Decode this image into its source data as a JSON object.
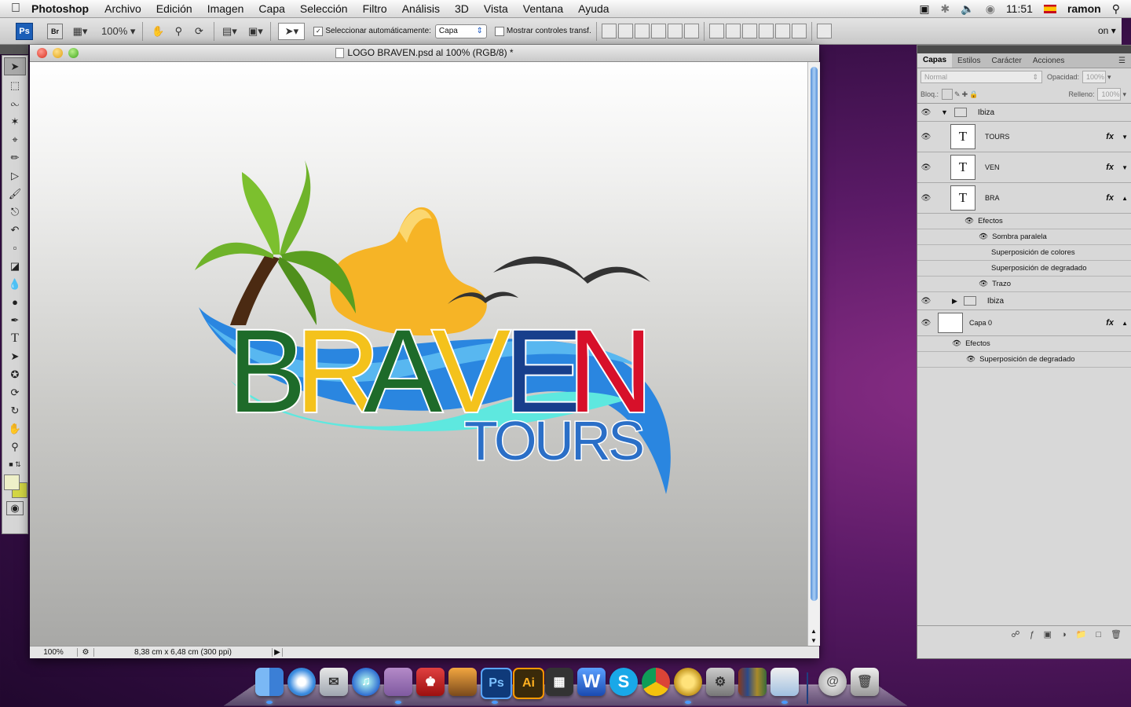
{
  "menubar": {
    "app_name": "Photoshop",
    "menus": [
      "Archivo",
      "Edición",
      "Imagen",
      "Capa",
      "Selección",
      "Filtro",
      "Análisis",
      "3D",
      "Vista",
      "Ventana",
      "Ayuda"
    ],
    "clock": "11:51",
    "user": "ramon"
  },
  "options": {
    "ps_logo": "Ps",
    "br_logo": "Br",
    "zoom": "100%",
    "auto_select_label": "Seleccionar automáticamente:",
    "auto_select_value": "Capa",
    "show_transform_label": "Mostrar controles transf.",
    "trailing_label": "on"
  },
  "document": {
    "title": "LOGO BRAVEN.psd al 100% (RGB/8) *",
    "status_zoom": "100%",
    "status_info": "8,38 cm x 6,48 cm (300 ppi)"
  },
  "logo": {
    "letters": [
      "B",
      "R",
      "A",
      "V",
      "E",
      "N"
    ],
    "subtitle": "TOURS",
    "colors": {
      "green": "#1e6b2a",
      "yellow": "#f4c21c",
      "navy": "#183f8c",
      "red": "#d7102a",
      "blue": "#2b6fc7",
      "cyan": "#5ee8df",
      "sun": "#f6b426",
      "palm": "#6fb32a",
      "trunk": "#4b2a12"
    }
  },
  "layers_panel": {
    "tabs": [
      "Capas",
      "Estilos",
      "Carácter",
      "Acciones"
    ],
    "blend_mode": "Normal",
    "opacity_label": "Opacidad:",
    "opacity_value": "100%",
    "lock_label": "Bloq.:",
    "fill_label": "Relleno:",
    "fill_value": "100%",
    "group_name": "Ibiza",
    "layers": [
      {
        "name": "TOURS",
        "thumb": "T",
        "fx": "fx"
      },
      {
        "name": "VEN",
        "thumb": "T",
        "fx": "fx"
      },
      {
        "name": "BRA",
        "thumb": "T",
        "fx": "fx"
      }
    ],
    "bra_effects_label": "Efectos",
    "bra_effects": [
      "Sombra paralela",
      "Superposición de colores",
      "Superposición de degradado",
      "Trazo"
    ],
    "nested_group": "Ibiza",
    "base_layer": {
      "name": "Capa 0",
      "fx": "fx"
    },
    "base_effects_label": "Efectos",
    "base_effects": [
      "Superposición de degradado"
    ]
  },
  "dock": {
    "apps": [
      "Finder",
      "Safari",
      "Mail",
      "iTunes",
      "Ticket",
      "Front Row",
      "iPhoto",
      "Photoshop",
      "Illustrator",
      "Dashboard",
      "Word",
      "Skype",
      "Chrome",
      "Sun",
      "System Preferences",
      "Library",
      "Preview",
      "Mail Alias",
      "Trash"
    ],
    "ps_label": "Ps",
    "ai_label": "Ai",
    "word_label": "W",
    "skype_label": "S"
  }
}
